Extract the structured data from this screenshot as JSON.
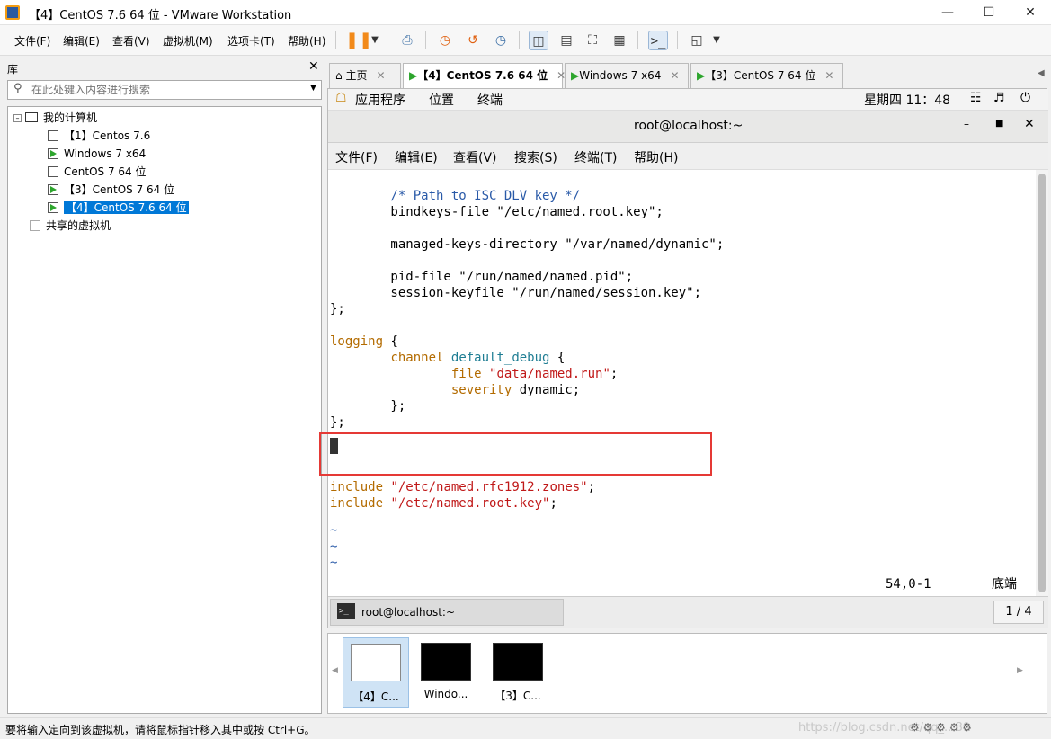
{
  "window": {
    "title": "【4】CentOS 7.6 64 位 - VMware Workstation"
  },
  "menu": [
    "文件(F)",
    "编辑(E)",
    "查看(V)",
    "虚拟机(M)",
    "选项卡(T)",
    "帮助(H)"
  ],
  "library": {
    "title": "库",
    "search_placeholder": "在此处键入内容进行搜索",
    "tree": {
      "root": "我的计算机",
      "items": [
        "【1】Centos 7.6",
        "Windows 7 x64",
        "CentOS 7 64 位",
        "【3】CentOS 7 64 位",
        "【4】CentOS 7.6 64 位"
      ],
      "shared": "共享的虚拟机"
    }
  },
  "tabs": [
    {
      "label": "主页"
    },
    {
      "label": "【4】CentOS 7.6 64 位"
    },
    {
      "label": "Windows 7 x64"
    },
    {
      "label": "【3】CentOS 7 64 位"
    }
  ],
  "guest": {
    "gnome": {
      "apps": "应用程序",
      "places": "位置",
      "terminal": "终端",
      "clock": "星期四 11：48"
    },
    "terminal": {
      "title": "root@localhost:~",
      "menu": [
        "文件(F)",
        "编辑(E)",
        "查看(V)",
        "搜索(S)",
        "终端(T)",
        "帮助(H)"
      ],
      "status_pos": "54,0-1",
      "status_where": "底端",
      "task_label": "root@localhost:~",
      "page": "1 / 4"
    }
  },
  "thumbnails": [
    {
      "label": "【4】C..."
    },
    {
      "label": "Windo..."
    },
    {
      "label": "【3】C..."
    }
  ],
  "status": {
    "text": "要将输入定向到该虚拟机，请将鼠标指针移入其中或按 Ctrl+G。",
    "watermark": "https://blog.csdn.net/qq_...80"
  },
  "colors": {
    "highlight_box": "#e53935",
    "selection": "#0078d7",
    "pause_icon": "#f28a1a"
  }
}
